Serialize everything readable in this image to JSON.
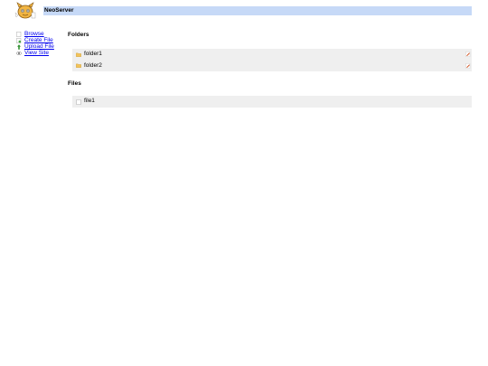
{
  "app": {
    "title": "NeoServer"
  },
  "sidebar": {
    "items": [
      {
        "label": "Browse",
        "icon": "page-icon"
      },
      {
        "label": "Create File",
        "icon": "new-file-icon"
      },
      {
        "label": "Upload File",
        "icon": "upload-icon"
      },
      {
        "label": "View Site",
        "icon": "eye-icon"
      }
    ]
  },
  "folders": {
    "heading": "Folders",
    "items": [
      {
        "name": "folder1",
        "icon": "folder-icon"
      },
      {
        "name": "folder2",
        "icon": "folder-icon"
      }
    ]
  },
  "files": {
    "heading": "Files",
    "items": [
      {
        "name": "file1",
        "icon": "file-icon"
      }
    ]
  },
  "colors": {
    "title_bar": "#c6d9f7",
    "list_background": "#efefef",
    "link": "#0000ee",
    "folder": "#f3c35a"
  }
}
